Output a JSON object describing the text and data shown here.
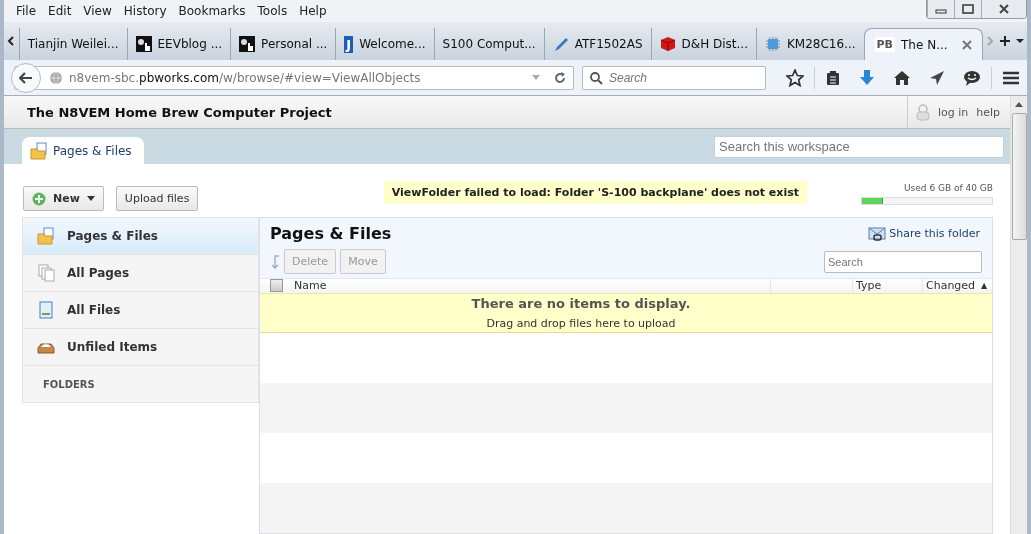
{
  "menu": [
    "File",
    "Edit",
    "View",
    "History",
    "Bookmarks",
    "Tools",
    "Help"
  ],
  "tabs": [
    {
      "title": "Tianjin Weilei...",
      "selected": false
    },
    {
      "title": "EEVblog ...",
      "selected": false
    },
    {
      "title": "Personal ...",
      "selected": false
    },
    {
      "title": "Welcome...",
      "favicon_text": "J",
      "selected": false
    },
    {
      "title": "S100 Comput...",
      "selected": false
    },
    {
      "title": "ATF1502AS",
      "selected": false
    },
    {
      "title": "D&H Dist...",
      "selected": false
    },
    {
      "title": "KM28C16...",
      "selected": false
    },
    {
      "title": "The N...",
      "favicon_text": "PB",
      "selected": true
    }
  ],
  "address": {
    "prefix": "n8vem-sbc.",
    "domain": "pbworks.com",
    "path": "/w/browse/#view=ViewAllObjects"
  },
  "browser_search": {
    "placeholder": "Search"
  },
  "site": {
    "title": "The N8VEM Home Brew Computer Project",
    "links": [
      "log in",
      "help"
    ]
  },
  "page_tab": {
    "label": "Pages & Files"
  },
  "workspace_search": {
    "placeholder": "Search this workspace"
  },
  "actions": {
    "new": "New",
    "upload": "Upload files"
  },
  "error": "ViewFolder failed to load: Folder 'S-100 backplane' does not exist",
  "storage": {
    "label": "Used 6 GB of 40 GB",
    "level": 0.15
  },
  "sidebar": {
    "items": [
      {
        "label": "Pages & Files",
        "selected": true
      },
      {
        "label": "All Pages",
        "selected": false
      },
      {
        "label": "All Files",
        "selected": false
      },
      {
        "label": "Unfiled Items",
        "selected": false
      }
    ],
    "section": "FOLDERS"
  },
  "panel": {
    "title": "Pages & Files",
    "share": "Share this folder",
    "buttons": [
      {
        "label": "Delete",
        "disabled": true
      },
      {
        "label": "Move",
        "disabled": true
      }
    ],
    "search_placeholder": "Search"
  },
  "table": {
    "all_checked": false,
    "name_column": "Name",
    "type_column": "Type",
    "changed_column": {
      "label": "Changed",
      "sort_mark": "▲"
    },
    "empty_title": "There are no items to display.",
    "empty_hint": "Drag and drop files here to upload"
  }
}
